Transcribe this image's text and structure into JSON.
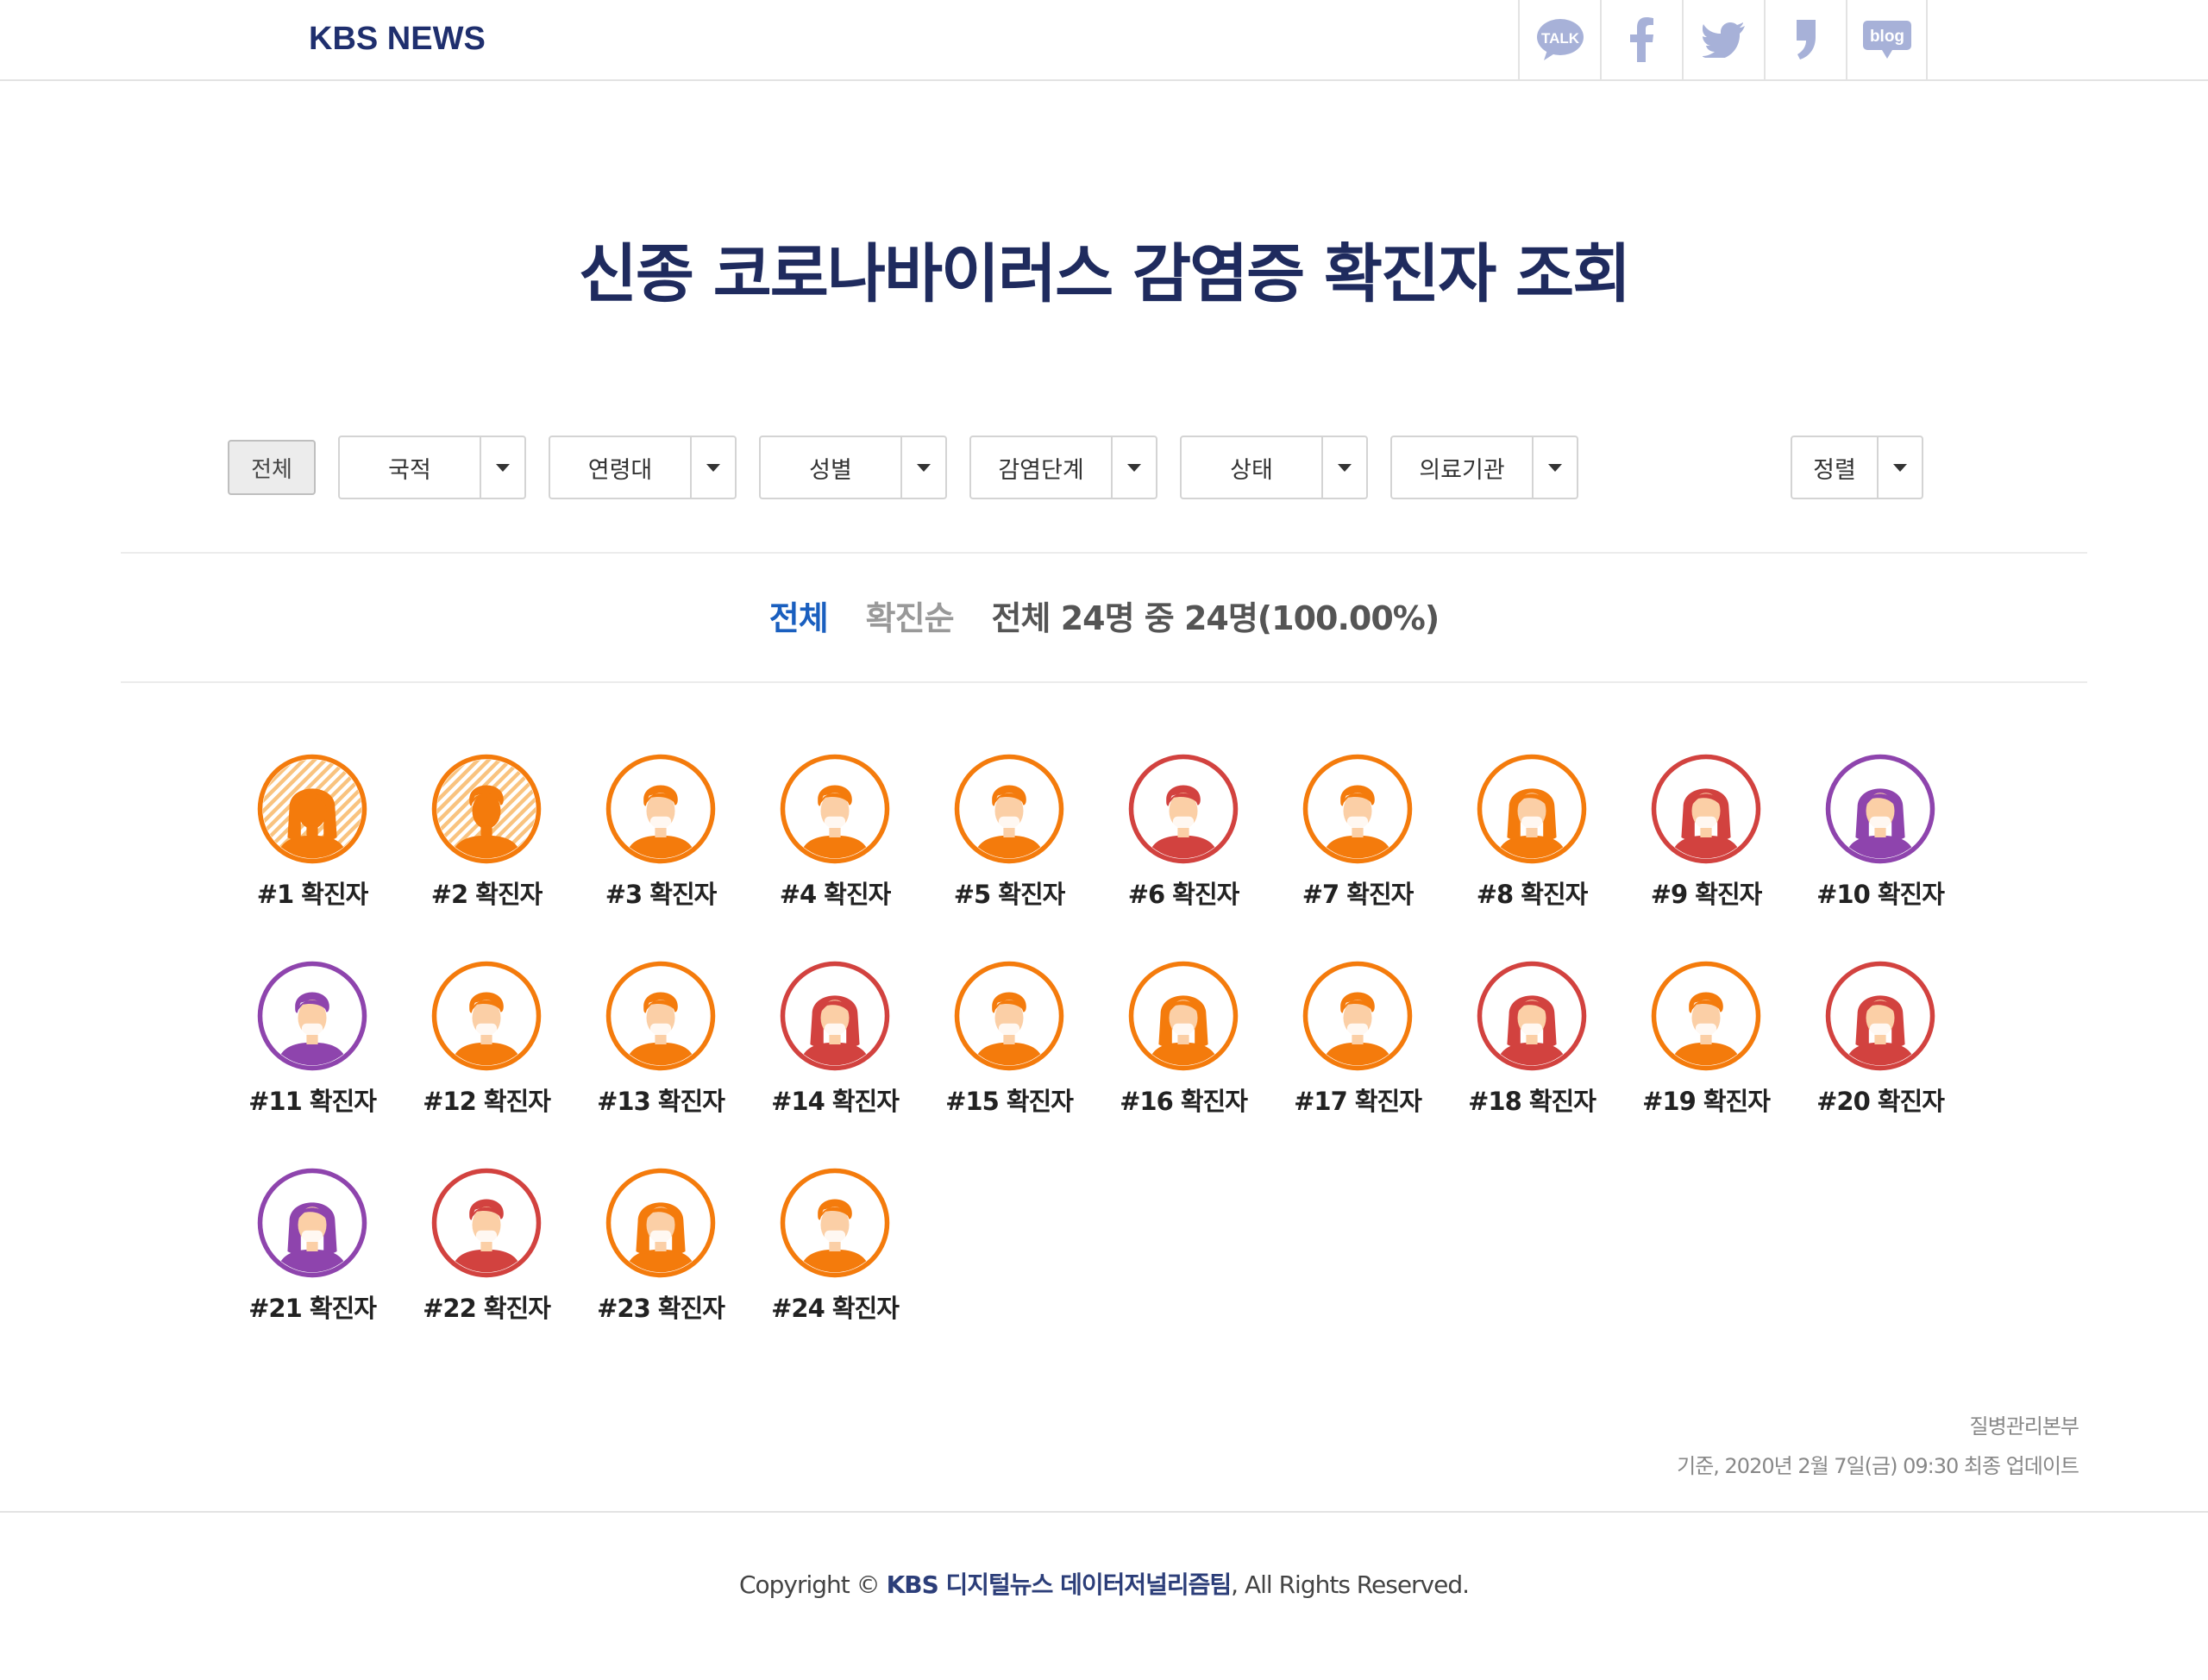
{
  "header": {
    "logo": "KBS NEWS",
    "social": [
      {
        "icon": "kakaotalk-icon",
        "text": "TALK"
      },
      {
        "icon": "facebook-icon",
        "text": ""
      },
      {
        "icon": "twitter-icon",
        "text": ""
      },
      {
        "icon": "kakaostory-icon",
        "text": ""
      },
      {
        "icon": "blog-icon",
        "text": "blog"
      }
    ]
  },
  "title": "신종 코로나바이러스 감염증 확진자 조회",
  "filters": {
    "all_label": "전체",
    "dropdowns": [
      "국적",
      "연령대",
      "성별",
      "감염단계",
      "상태",
      "의료기관"
    ],
    "sort_label": "정렬"
  },
  "summary": {
    "view": "전체",
    "order": "확진순",
    "count_text": "전체 24명 중 24명(100.00%)"
  },
  "colors": {
    "orange": "#f47b0c",
    "red": "#d2423f",
    "purple": "#8e44ad",
    "light_orange": "#f9c37f",
    "title": "#1f2b5e",
    "accent_blue": "#1a5fbf"
  },
  "patients": [
    {
      "label": "#1 확진자",
      "color": "orange",
      "gender": "female",
      "status": "released"
    },
    {
      "label": "#2 확진자",
      "color": "orange",
      "gender": "male",
      "status": "released"
    },
    {
      "label": "#3 확진자",
      "color": "orange",
      "gender": "male",
      "status": "active"
    },
    {
      "label": "#4 확진자",
      "color": "orange",
      "gender": "male",
      "status": "active"
    },
    {
      "label": "#5 확진자",
      "color": "orange",
      "gender": "male",
      "status": "active"
    },
    {
      "label": "#6 확진자",
      "color": "red",
      "gender": "male",
      "status": "active"
    },
    {
      "label": "#7 확진자",
      "color": "orange",
      "gender": "male",
      "status": "active"
    },
    {
      "label": "#8 확진자",
      "color": "orange",
      "gender": "female",
      "status": "active"
    },
    {
      "label": "#9 확진자",
      "color": "red",
      "gender": "female",
      "status": "active"
    },
    {
      "label": "#10 확진자",
      "color": "purple",
      "gender": "female",
      "status": "active"
    },
    {
      "label": "#11 확진자",
      "color": "purple",
      "gender": "male",
      "status": "active"
    },
    {
      "label": "#12 확진자",
      "color": "orange",
      "gender": "male",
      "status": "active"
    },
    {
      "label": "#13 확진자",
      "color": "orange",
      "gender": "male",
      "status": "active"
    },
    {
      "label": "#14 확진자",
      "color": "red",
      "gender": "female",
      "status": "active"
    },
    {
      "label": "#15 확진자",
      "color": "orange",
      "gender": "male",
      "status": "active"
    },
    {
      "label": "#16 확진자",
      "color": "orange",
      "gender": "female",
      "status": "active"
    },
    {
      "label": "#17 확진자",
      "color": "orange",
      "gender": "male",
      "status": "active"
    },
    {
      "label": "#18 확진자",
      "color": "red",
      "gender": "female",
      "status": "active"
    },
    {
      "label": "#19 확진자",
      "color": "orange",
      "gender": "male",
      "status": "active"
    },
    {
      "label": "#20 확진자",
      "color": "red",
      "gender": "female",
      "status": "active"
    },
    {
      "label": "#21 확진자",
      "color": "purple",
      "gender": "female",
      "status": "active"
    },
    {
      "label": "#22 확진자",
      "color": "red",
      "gender": "male",
      "status": "active"
    },
    {
      "label": "#23 확진자",
      "color": "orange",
      "gender": "female",
      "status": "active"
    },
    {
      "label": "#24 확진자",
      "color": "orange",
      "gender": "male",
      "status": "active"
    }
  ],
  "footer": {
    "source": "질병관리본부",
    "updated": "기준, 2020년 2월 7일(금) 09:30 최종 업데이트",
    "copyright_prefix": "Copyright ©",
    "copyright_team": "KBS 디지털뉴스 데이터저널리즘팀",
    "copyright_suffix": ", All Rights Reserved."
  }
}
